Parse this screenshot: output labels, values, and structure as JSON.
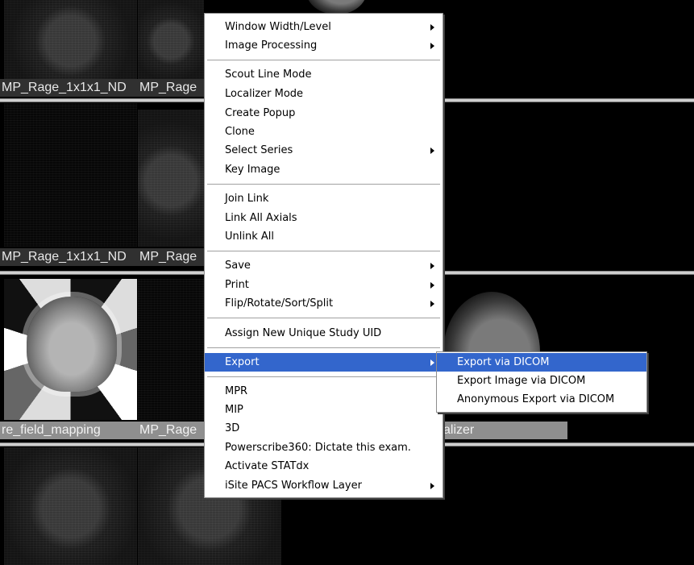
{
  "viewports": {
    "row1_labels": [
      "MP_Rage_1x1x1_ND",
      "MP_Rage"
    ],
    "row2_labels": [
      "MP_Rage_1x1x1_ND",
      "MP_Rage"
    ],
    "row3_labels": [
      "re_field_mapping",
      "MP_Rage",
      "alizer"
    ]
  },
  "menu": {
    "items": [
      {
        "label": "Window Width/Level",
        "submenu": true
      },
      {
        "label": "Image Processing",
        "submenu": true
      },
      {
        "label": "Scout Line Mode",
        "submenu": false
      },
      {
        "label": "Localizer Mode",
        "submenu": false
      },
      {
        "label": "Create Popup",
        "submenu": false
      },
      {
        "label": "Clone",
        "submenu": false
      },
      {
        "label": "Select Series",
        "submenu": true
      },
      {
        "label": "Key Image",
        "submenu": false
      },
      {
        "label": "Join Link",
        "submenu": false
      },
      {
        "label": "Link All Axials",
        "submenu": false
      },
      {
        "label": "Unlink All",
        "submenu": false
      },
      {
        "label": "Save",
        "submenu": true
      },
      {
        "label": "Print",
        "submenu": true
      },
      {
        "label": "Flip/Rotate/Sort/Split",
        "submenu": true
      },
      {
        "label": "Assign New Unique Study UID",
        "submenu": false
      },
      {
        "label": "Export",
        "submenu": true,
        "selected": true
      },
      {
        "label": "MPR",
        "submenu": false
      },
      {
        "label": "MIP",
        "submenu": false
      },
      {
        "label": "3D",
        "submenu": false
      },
      {
        "label": "Powerscribe360: Dictate this exam.",
        "submenu": false
      },
      {
        "label": "Activate STATdx",
        "submenu": false
      },
      {
        "label": "iSite PACS Workflow Layer",
        "submenu": true
      }
    ]
  },
  "export_submenu": {
    "items": [
      {
        "label": "Export via DICOM",
        "selected": true
      },
      {
        "label": "Export Image via DICOM"
      },
      {
        "label": "Anonymous Export via DICOM"
      }
    ]
  },
  "colors": {
    "selection": "#3366cc",
    "menu_background": "#ffffff",
    "viewer_background": "#000000"
  }
}
